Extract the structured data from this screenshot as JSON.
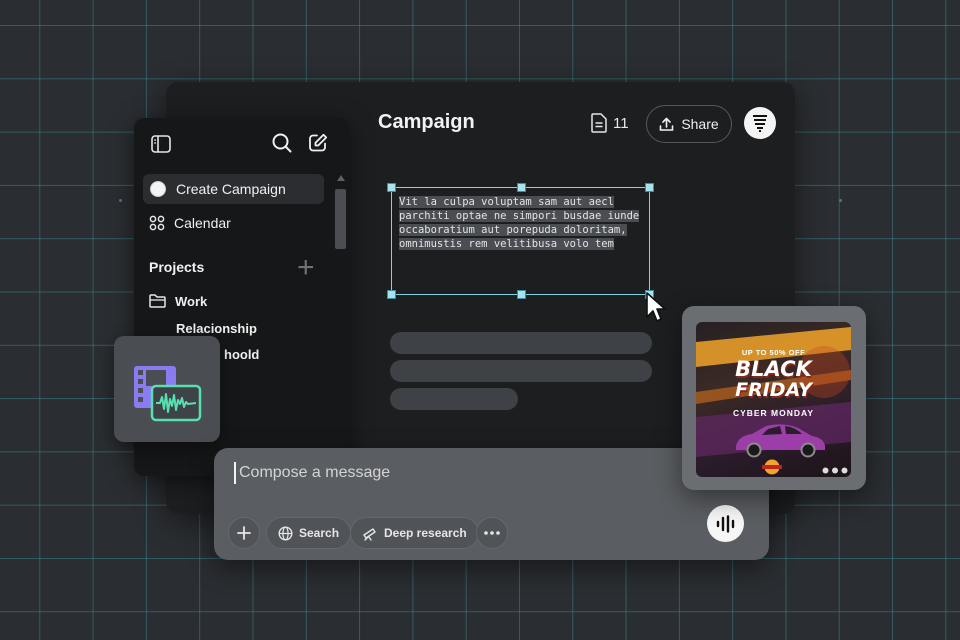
{
  "header": {
    "title": "Campaign",
    "doc_count": "11",
    "share_label": "Share"
  },
  "canvas": {
    "selected_text_lines": [
      "Vit la culpa voluptam sam aut aecl",
      "parchiti optae ne simpori busdae iunde",
      "occaboratium aut porepuda doloritam,",
      "omnimustis rem velitibusa volo tem"
    ]
  },
  "sidebar": {
    "items": [
      {
        "label": "Create Campaign",
        "icon": "circle-icon",
        "active": true
      },
      {
        "label": "Calendar",
        "icon": "grid-icon",
        "active": false
      }
    ],
    "projects_label": "Projects",
    "projects": [
      {
        "label": "Work",
        "icon": "folder-icon"
      },
      {
        "label": "Relacionship"
      },
      {
        "label": "hoold"
      }
    ]
  },
  "composer": {
    "placeholder": "Compose a message",
    "search_label": "Search",
    "deep_research_label": "Deep research"
  },
  "promo": {
    "tag": "UP TO 50% OFF",
    "line1": "BLACK",
    "line2": "FRIDAY",
    "sub": "CYBER MONDAY"
  },
  "colors": {
    "grid": "#3c96a0",
    "selection": "#7fd3e4",
    "media_clip": "#8a7cf0",
    "media_wave": "#56e0b0",
    "promo_car": "#9b3ea8"
  }
}
